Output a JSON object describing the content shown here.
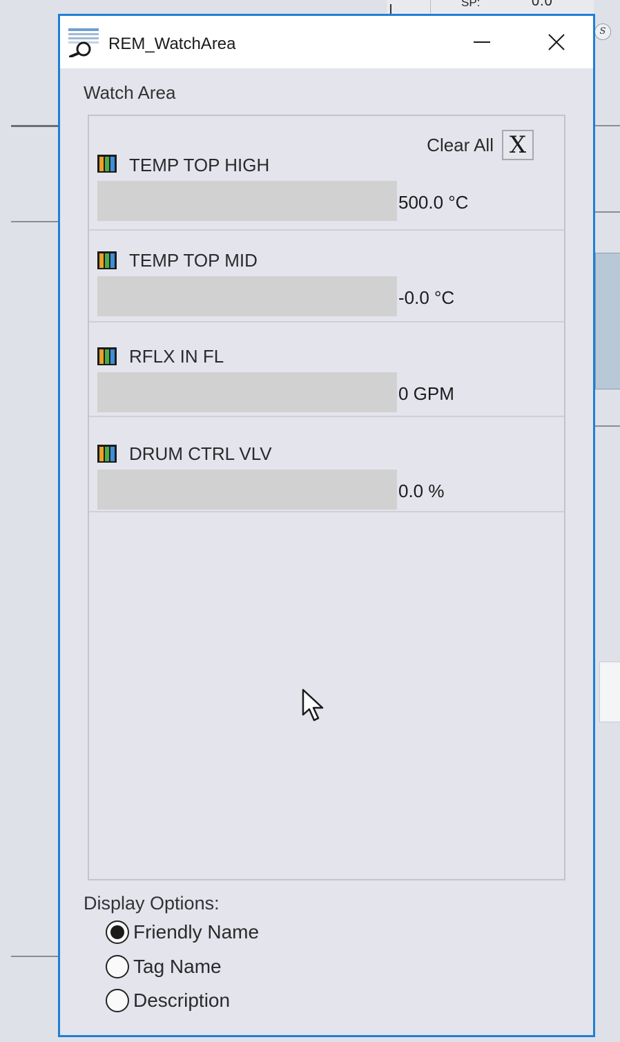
{
  "background": {
    "sp_label": "SP:",
    "sp_value": "0.0",
    "s_icon": "S"
  },
  "window": {
    "title": "REM_WatchArea",
    "icon": "watch-window-icon",
    "accent_color": "#1e7fd6"
  },
  "watch_area": {
    "title": "Watch Area",
    "clear_all_label": "Clear All",
    "clear_all_button": "X",
    "items": [
      {
        "name": "TEMP TOP HIGH",
        "value": "500.0 °C"
      },
      {
        "name": "TEMP TOP MID",
        "value": "-0.0 °C"
      },
      {
        "name": "RFLX IN FL",
        "value": "0 GPM"
      },
      {
        "name": "DRUM CTRL VLV",
        "value": "0.0 %"
      }
    ]
  },
  "display_options": {
    "title": "Display Options:",
    "options": [
      {
        "label": "Friendly Name",
        "selected": true
      },
      {
        "label": "Tag Name",
        "selected": false
      },
      {
        "label": "Description",
        "selected": false
      }
    ]
  }
}
